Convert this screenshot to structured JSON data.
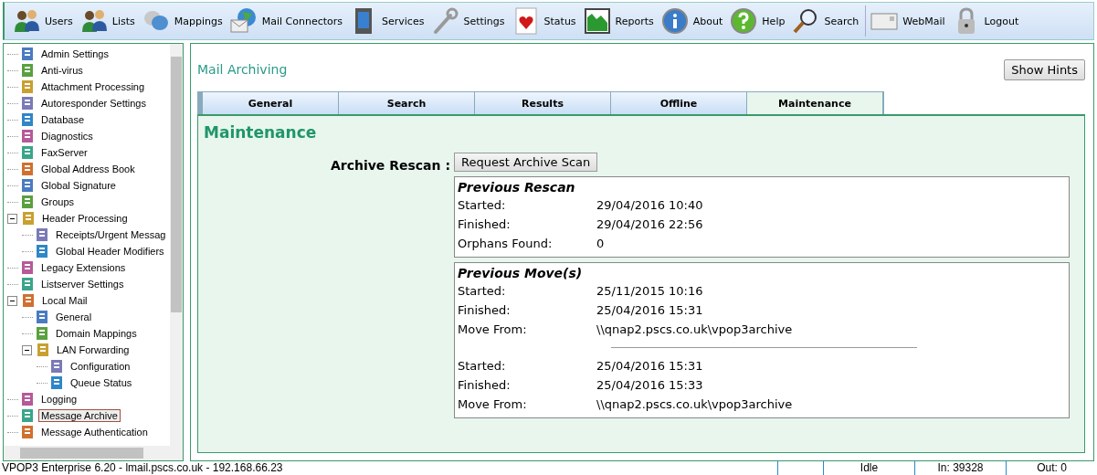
{
  "toolbar": [
    {
      "label": "Users"
    },
    {
      "label": "Lists"
    },
    {
      "label": "Mappings"
    },
    {
      "label": "Mail Connectors"
    },
    {
      "label": "Services"
    },
    {
      "label": "Settings"
    },
    {
      "label": "Status"
    },
    {
      "label": "Reports"
    },
    {
      "label": "About"
    },
    {
      "label": "Help"
    },
    {
      "label": "Search"
    },
    {
      "label": "WebMail"
    },
    {
      "label": "Logout"
    }
  ],
  "sidebar": {
    "items": [
      {
        "label": "Admin Settings",
        "selected": false
      },
      {
        "label": "Anti-virus",
        "selected": false
      },
      {
        "label": "Attachment Processing",
        "selected": false
      },
      {
        "label": "Autoresponder Settings",
        "selected": false
      },
      {
        "label": "Database",
        "selected": false
      },
      {
        "label": "Diagnostics",
        "selected": false
      },
      {
        "label": "FaxServer",
        "selected": false
      },
      {
        "label": "Global Address Book",
        "selected": false
      },
      {
        "label": "Global Signature",
        "selected": false
      },
      {
        "label": "Groups",
        "selected": false
      },
      {
        "label": "Header Processing",
        "selected": false,
        "expanded": true,
        "children": [
          {
            "label": "Receipts/Urgent Messag",
            "selected": false
          },
          {
            "label": "Global Header Modifiers",
            "selected": false
          }
        ]
      },
      {
        "label": "Legacy Extensions",
        "selected": false
      },
      {
        "label": "Listserver Settings",
        "selected": false
      },
      {
        "label": "Local Mail",
        "selected": false,
        "expanded": true,
        "children": [
          {
            "label": "General",
            "selected": false
          },
          {
            "label": "Domain Mappings",
            "selected": false
          },
          {
            "label": "LAN Forwarding",
            "selected": false,
            "expanded": true,
            "children": [
              {
                "label": "Configuration",
                "selected": false
              },
              {
                "label": "Queue Status",
                "selected": false
              }
            ]
          }
        ]
      },
      {
        "label": "Logging",
        "selected": false
      },
      {
        "label": "Message Archive",
        "selected": true
      },
      {
        "label": "Message Authentication",
        "selected": false
      }
    ]
  },
  "page": {
    "title": "Mail Archiving",
    "hints_button": "Show Hints",
    "tabs": [
      {
        "label": "General",
        "selected": false
      },
      {
        "label": "Search",
        "selected": false
      },
      {
        "label": "Results",
        "selected": false
      },
      {
        "label": "Offline",
        "selected": false
      },
      {
        "label": "Maintenance",
        "selected": true
      }
    ],
    "heading": "Maintenance",
    "rescan_label": "Archive Rescan :",
    "rescan_button": "Request Archive Scan",
    "previous_rescan": {
      "title": "Previous Rescan",
      "rows": [
        {
          "label": "Started:",
          "value": "29/04/2016 10:40"
        },
        {
          "label": "Finished:",
          "value": "29/04/2016 22:56"
        },
        {
          "label": "Orphans Found:",
          "value": "0"
        }
      ]
    },
    "previous_moves": {
      "title": "Previous Move(s)",
      "groups": [
        {
          "rows": [
            {
              "label": "Started:",
              "value": "25/11/2015 10:16"
            },
            {
              "label": "Finished:",
              "value": "25/04/2016 15:31"
            },
            {
              "label": "Move From:",
              "value": "\\\\qnap2.pscs.co.uk\\vpop3archive"
            }
          ]
        },
        {
          "rows": [
            {
              "label": "Started:",
              "value": "25/04/2016 15:31"
            },
            {
              "label": "Finished:",
              "value": "25/04/2016 15:33"
            },
            {
              "label": "Move From:",
              "value": "\\\\qnap2.pscs.co.uk\\vpop3archive"
            }
          ]
        }
      ]
    }
  },
  "status_bar": {
    "text": "VPOP3 Enterprise 6.20 - lmail.pscs.co.uk - 192.168.66.23",
    "cells": [
      "Idle",
      "In: 39328",
      "Out: 0"
    ]
  }
}
